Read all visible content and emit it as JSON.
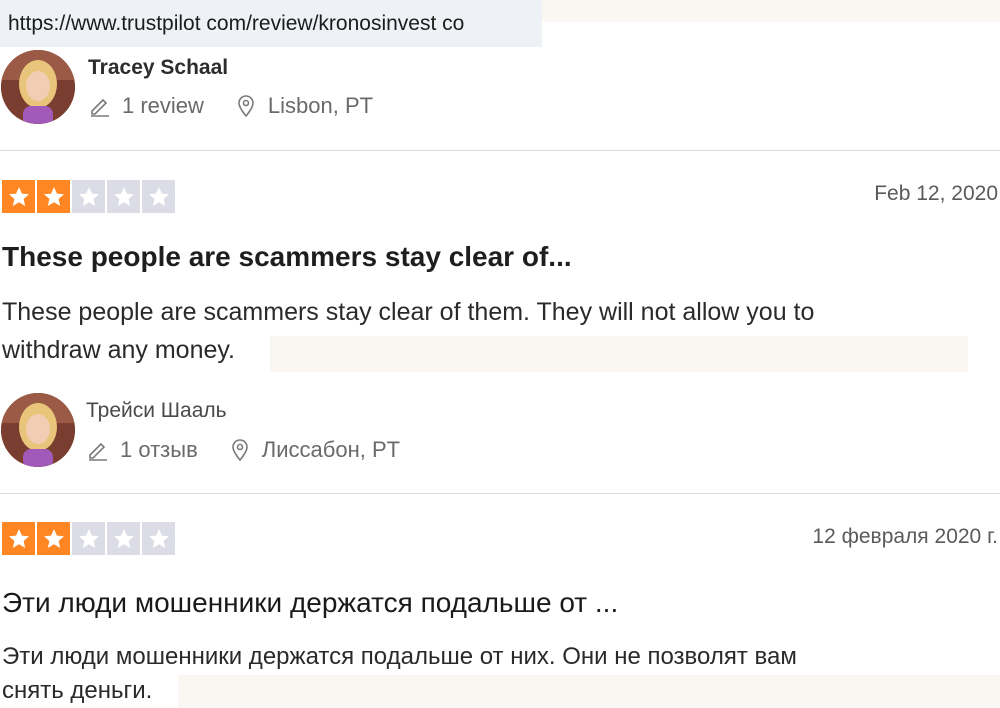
{
  "browser": {
    "url": "https://www.trustpilot com/review/kronosinvest co"
  },
  "reviews": [
    {
      "reviewer": {
        "name": "Tracey Schaal",
        "reviews_count": "1 review",
        "location": "Lisbon, PT"
      },
      "rating": 2,
      "date": "Feb 12, 2020",
      "title": "These people are scammers stay clear of...",
      "body_line1": "These people are scammers stay clear of them. They will not allow you to",
      "body_line2": "withdraw any money."
    },
    {
      "reviewer": {
        "name": "Трейси Шааль",
        "reviews_count": "1 отзыв",
        "location": "Лиссабон, PT"
      },
      "rating": 2,
      "date": "12 февраля 2020 г.",
      "title": "Эти люди мошенники держатся подальше от ...",
      "body_line1": "Эти люди мошенники держатся подальше от них. Они не позволят вам",
      "body_line2": "снять деньги."
    }
  ],
  "colors": {
    "star_on": "#ff8622",
    "star_off": "#dcdce6",
    "divider": "#dcdcdc"
  },
  "icons": {
    "reviews": "pencil-icon",
    "location": "map-pin-icon",
    "star": "star-icon"
  }
}
